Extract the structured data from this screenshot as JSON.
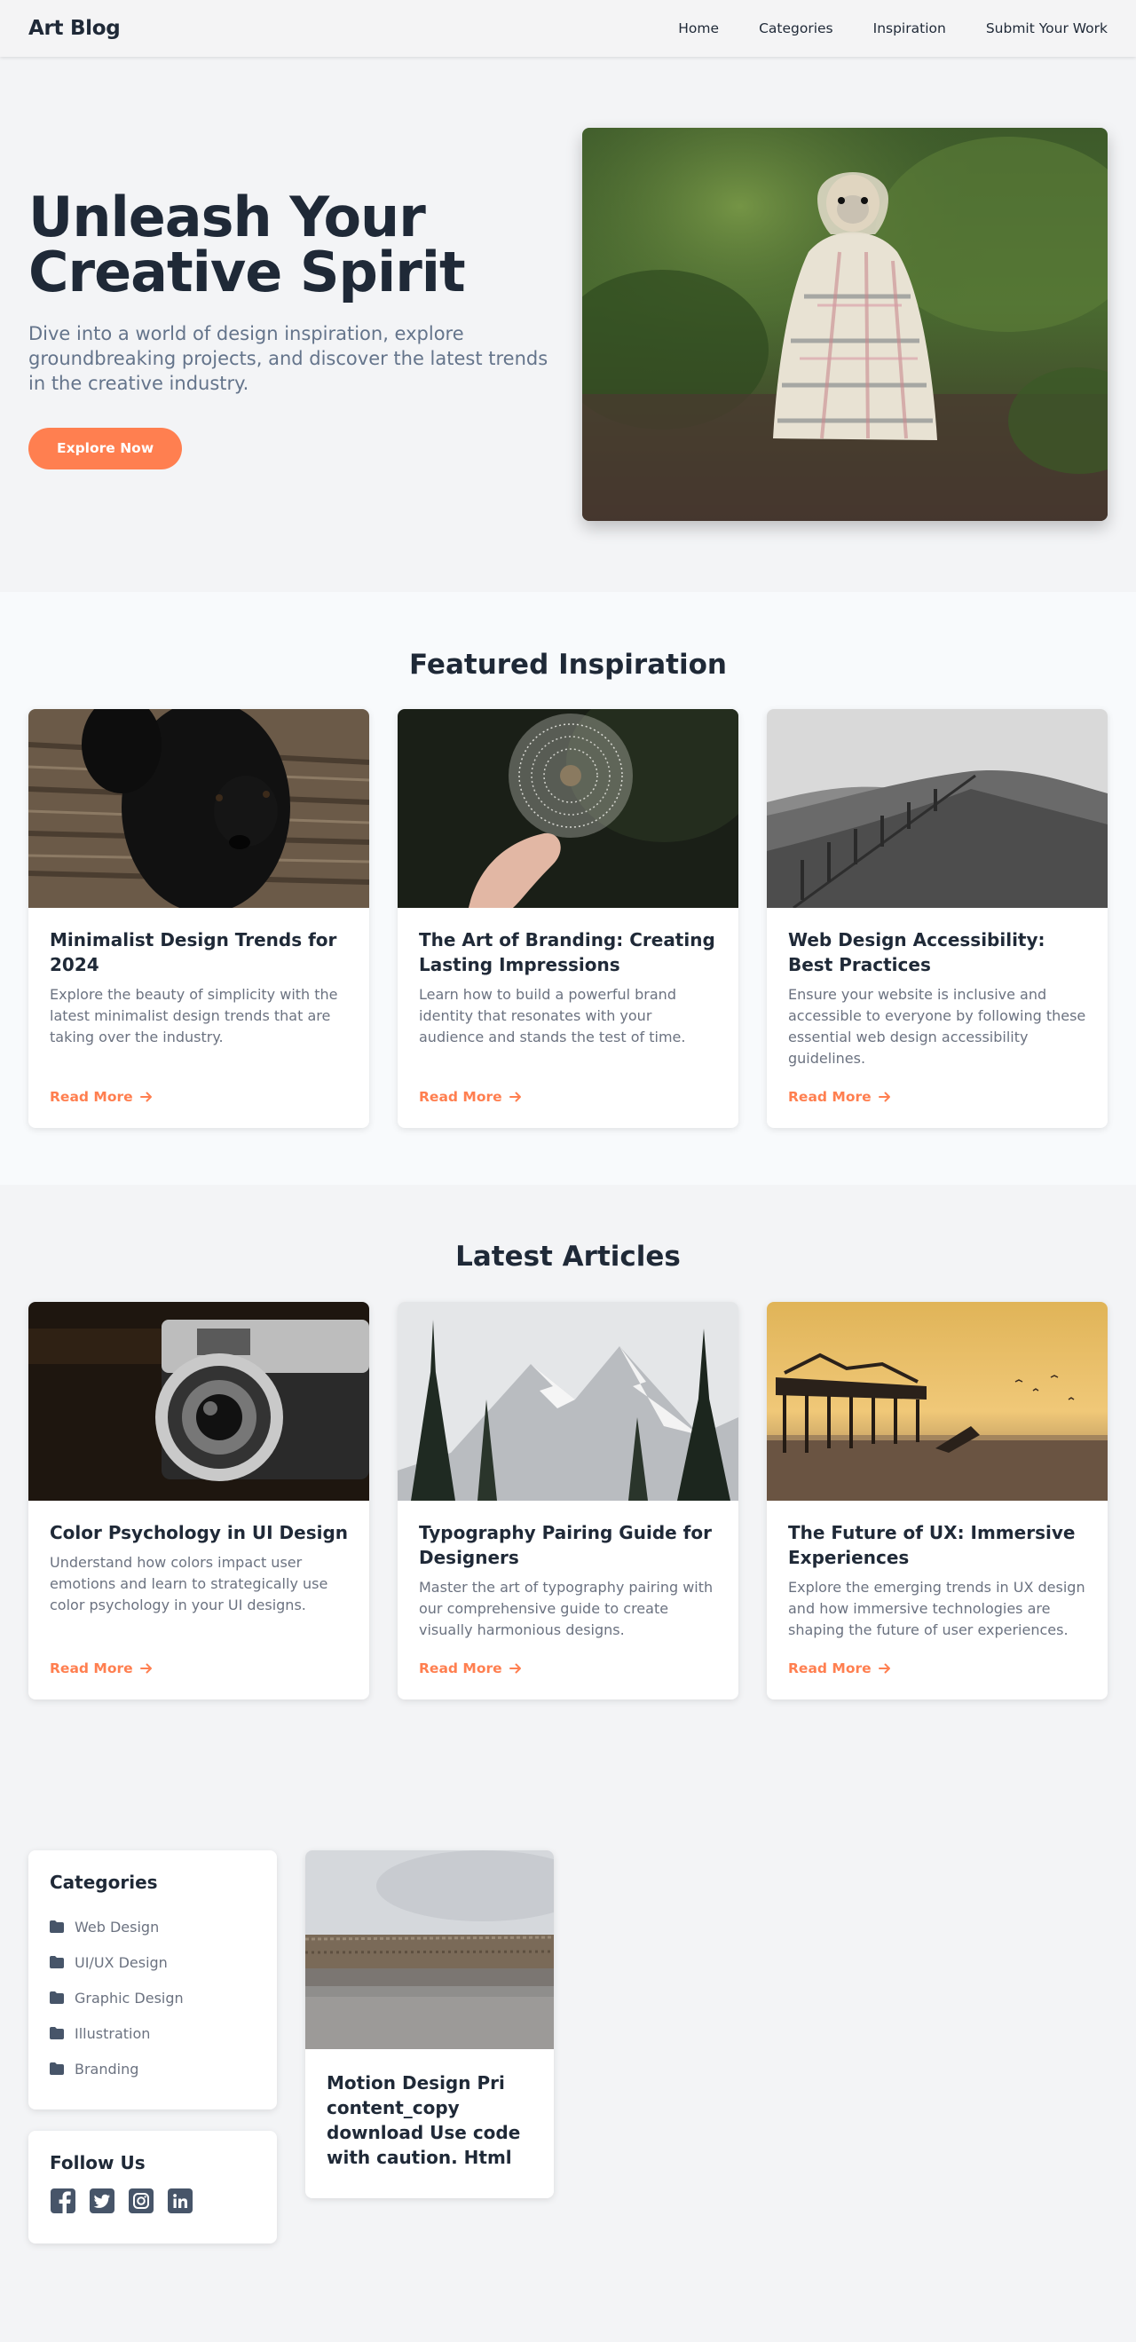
{
  "nav": {
    "brand": "Art Blog",
    "links": [
      "Home",
      "Categories",
      "Inspiration",
      "Submit Your Work"
    ]
  },
  "hero": {
    "title_line1": "Unleash Your",
    "title_line2": "Creative Spirit",
    "subtitle": "Dive into a world of design inspiration, explore groundbreaking projects, and discover the latest trends in the creative industry.",
    "cta": "Explore Now"
  },
  "featured": {
    "title": "Featured Inspiration",
    "cards": [
      {
        "title": "Minimalist Design Trends for 2024",
        "desc": "Explore the beauty of simplicity with the latest minimalist design trends that are taking over the industry.",
        "link": "Read More"
      },
      {
        "title": "The Art of Branding: Creating Lasting Impressions",
        "desc": "Learn how to build a powerful brand identity that resonates with your audience and stands the test of time.",
        "link": "Read More"
      },
      {
        "title": "Web Design Accessibility: Best Practices",
        "desc": "Ensure your website is inclusive and accessible to everyone by following these essential web design accessibility guidelines.",
        "link": "Read More"
      }
    ]
  },
  "latest": {
    "title": "Latest Articles",
    "cards": [
      {
        "title": "Color Psychology in UI Design",
        "desc": "Understand how colors impact user emotions and learn to strategically use color psychology in your UI designs.",
        "link": "Read More"
      },
      {
        "title": "Typography Pairing Guide for Designers",
        "desc": "Master the art of typography pairing with our comprehensive guide to create visually harmonious designs.",
        "link": "Read More"
      },
      {
        "title": "The Future of UX: Immersive Experiences",
        "desc": "Explore the emerging trends in UX design and how immersive technologies are shaping the future of user experiences.",
        "link": "Read More"
      }
    ]
  },
  "sidebar": {
    "categories_title": "Categories",
    "categories": [
      "Web Design",
      "UI/UX Design",
      "Graphic Design",
      "Illustration",
      "Branding"
    ],
    "follow_title": "Follow Us",
    "social_icons": [
      "facebook-icon",
      "twitter-icon",
      "instagram-icon",
      "linkedin-icon"
    ]
  },
  "motion_card": {
    "title": "Motion Design Pri content_copy download Use code with caution. Html"
  },
  "colors": {
    "accent": "#ff7f50",
    "text_dark": "#1f2937",
    "text_muted": "#6b7280",
    "icon_slate": "#475569"
  }
}
